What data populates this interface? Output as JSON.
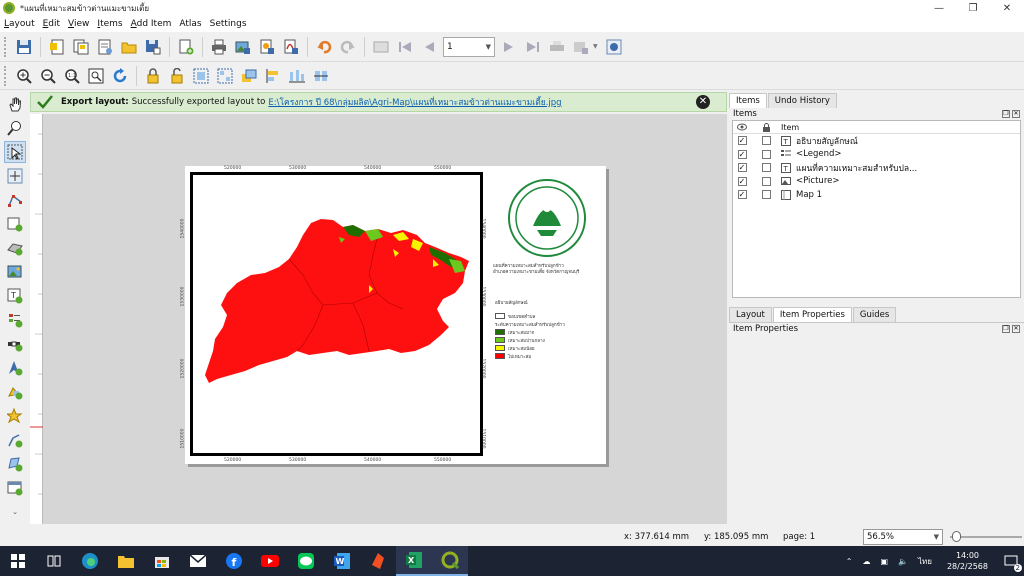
{
  "window": {
    "title": "*แผนที่เหมาะสมข้าวต่านแมะขามเตี้ย"
  },
  "menu": [
    {
      "label": "Layout",
      "key": "L"
    },
    {
      "label": "Edit",
      "key": "E"
    },
    {
      "label": "View",
      "key": "V"
    },
    {
      "label": "Items",
      "key": "I"
    },
    {
      "label": "Add Item",
      "key": "A"
    },
    {
      "label": "Atlas",
      "key": ""
    },
    {
      "label": "Settings",
      "key": ""
    }
  ],
  "toolbar": {
    "page_value": "1"
  },
  "message_bar": {
    "title": "Export layout:",
    "message": "Successfully exported layout to",
    "link": "E:\\โครงการ ปี 68\\กลุ่มผลิต\\Agri-Map\\แผนที่เหมาะสมข้าวต่านแมะขามเตี้ย.jpg"
  },
  "layout_paper": {
    "top_coords": [
      "520000",
      "530000",
      "540000",
      "550000"
    ],
    "bottom_coords": [
      "520000",
      "530000",
      "540000",
      "550000"
    ],
    "left_coords": [
      "1540000",
      "1530000",
      "1520000",
      "1510000"
    ],
    "right_coords": [
      "1540000",
      "1530000",
      "1520000",
      "1510000"
    ],
    "map_title": [
      "แผนที่ความเหมาะสมสำหรับปลูกข้าว",
      "อำเภอความเหมาะขามเตี้ย จังหวัดกาญจนบุรี"
    ],
    "legend_title": "อธิบายสัญลักษณ์",
    "legend_items": [
      {
        "label": "ขอบเขตตำบล",
        "color": "#ffffff"
      },
      {
        "label": "ระดับความเหมาะสมสำหรับปลูกข้าว",
        "color": ""
      },
      {
        "label": "เหมาะสมมาก",
        "color": "#1e6e00"
      },
      {
        "label": "เหมาะสมปานกลาง",
        "color": "#6bc81e"
      },
      {
        "label": "เหมาะสมน้อย",
        "color": "#f5f500"
      },
      {
        "label": "ไม่เหมาะสม",
        "color": "#ff0000"
      }
    ],
    "map_fill_color": "#ff1010"
  },
  "right_panel": {
    "top_tabs": [
      "Items",
      "Undo History"
    ],
    "items_label": "Items",
    "tree_header": "Item",
    "items": [
      {
        "name": "อธิบายสัญลักษณ์",
        "type": "text",
        "visible": true
      },
      {
        "name": "<Legend>",
        "type": "legend",
        "visible": true
      },
      {
        "name": "แผนที่ความเหมาะสมสำหรับปล...",
        "type": "text",
        "visible": true
      },
      {
        "name": "<Picture>",
        "type": "picture",
        "visible": true
      },
      {
        "name": "Map 1",
        "type": "map",
        "visible": true
      }
    ],
    "bottom_tabs": [
      "Layout",
      "Item Properties",
      "Guides"
    ],
    "item_properties_label": "Item Properties"
  },
  "status": {
    "x": "x: 377.614 mm",
    "y": "y: 185.095 mm",
    "page": "page: 1",
    "zoom": "56.5%"
  },
  "taskbar": {
    "time": "14:00",
    "date": "28/2/2568",
    "lang": "ไทย",
    "notif_count": "2"
  }
}
